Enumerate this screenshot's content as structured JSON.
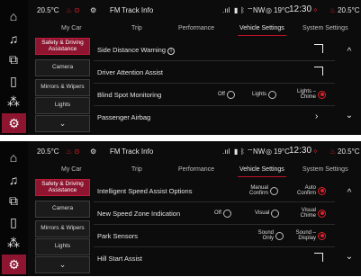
{
  "rail_icons": [
    "home-icon",
    "music-note-icon",
    "media-player-icon",
    "phone-icon",
    "climate-fan-icon",
    "vehicle-settings-icon"
  ],
  "screens": [
    {
      "status": {
        "outside_temp": "20.5°C",
        "source": "FM",
        "track": "Track Info",
        "compass": "NW",
        "temp_right": "19°C",
        "clock": "12:30",
        "driver_temp": "20.5°C"
      },
      "tabs": [
        "My Car",
        "Trip",
        "Performance",
        "Vehicle Settings",
        "System Settings"
      ],
      "categories": [
        "Safety & Driving Assistance",
        "Camera",
        "Mirrors & Wipers",
        "Lights",
        "⌄"
      ],
      "rows": [
        {
          "label": "Side Distance Warning",
          "info": "i"
        },
        {
          "label": "Driver Attention Assist"
        },
        {
          "label": "Blind Spot Monitoring",
          "options": [
            "Off",
            "Lights",
            "Lights – Chime"
          ],
          "selected": 2
        },
        {
          "label": "Passenger Airbag",
          "arrow": "›"
        }
      ]
    },
    {
      "status": {
        "outside_temp": "20.5°C",
        "source": "FM",
        "track": "Track Info",
        "compass": "NW",
        "temp_right": "19°C",
        "clock": "12:30",
        "driver_temp": "20.5°C"
      },
      "tabs": [
        "My Car",
        "Trip",
        "Performance",
        "Vehicle Settings",
        "System Settings"
      ],
      "categories": [
        "Safety & Driving Assistance",
        "Camera",
        "Mirrors & Wipers",
        "Lights",
        "⌄"
      ],
      "rows": [
        {
          "label": "Intelligent Speed Assist Options",
          "options": [
            "Manual Confirm",
            "Auto Confirm"
          ],
          "selected": 1
        },
        {
          "label": "New Speed Zone Indication",
          "options": [
            "Off",
            "Visual",
            "Visual Chime"
          ],
          "selected": 2
        },
        {
          "label": "Park Sensors",
          "options": [
            "Sound Only",
            "Sound – Display"
          ],
          "selected": 1
        },
        {
          "label": "Hill Start Assist"
        }
      ]
    }
  ],
  "scroll": {
    "up": "^",
    "down": "⌄"
  },
  "colors": {
    "accent": "#8d1530",
    "active_red": "#e0202a",
    "background": "#0c0c0c"
  }
}
